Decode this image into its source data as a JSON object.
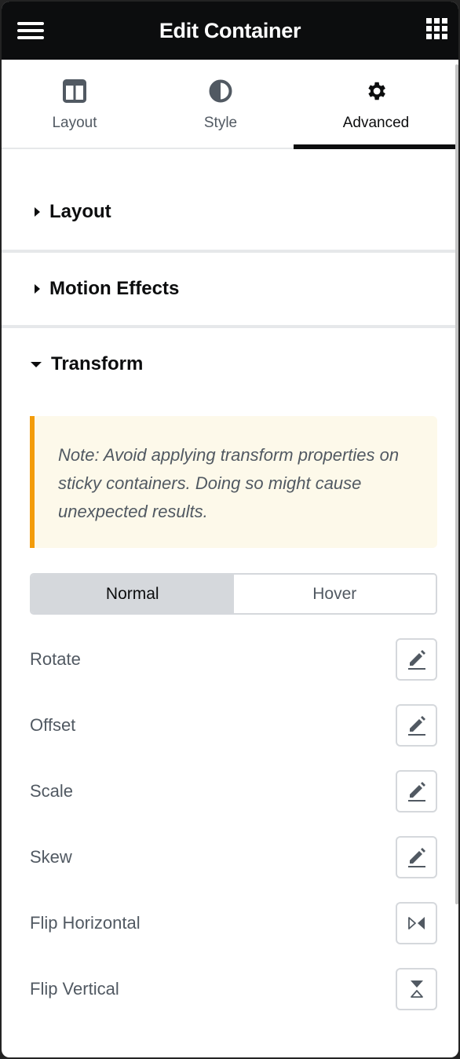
{
  "header": {
    "title": "Edit Container",
    "menu_icon": "hamburger-icon",
    "apps_icon": "grid-icon"
  },
  "tabs": [
    {
      "label": "Layout",
      "icon": "columns-icon",
      "active": false
    },
    {
      "label": "Style",
      "icon": "half-circle-icon",
      "active": false
    },
    {
      "label": "Advanced",
      "icon": "gear-icon",
      "active": true
    }
  ],
  "sections": [
    {
      "title": "Layout",
      "expanded": false
    },
    {
      "title": "Motion Effects",
      "expanded": false
    },
    {
      "title": "Transform",
      "expanded": true
    }
  ],
  "transform": {
    "note": "Note: Avoid applying transform properties on sticky containers. Doing so might cause unexpected results.",
    "state_tabs": [
      {
        "label": "Normal",
        "active": true
      },
      {
        "label": "Hover",
        "active": false
      }
    ],
    "controls": [
      {
        "label": "Rotate",
        "icon": "pencil-icon"
      },
      {
        "label": "Offset",
        "icon": "pencil-icon"
      },
      {
        "label": "Scale",
        "icon": "pencil-icon"
      },
      {
        "label": "Skew",
        "icon": "pencil-icon"
      },
      {
        "label": "Flip Horizontal",
        "icon": "flip-horizontal-icon"
      },
      {
        "label": "Flip Vertical",
        "icon": "flip-vertical-icon"
      }
    ]
  },
  "colors": {
    "header_bg": "#0c0d0e",
    "text_secondary": "#515962",
    "alert_bg": "#fdf9ea",
    "alert_border": "#f39c0a",
    "border": "#d5d8dc"
  }
}
